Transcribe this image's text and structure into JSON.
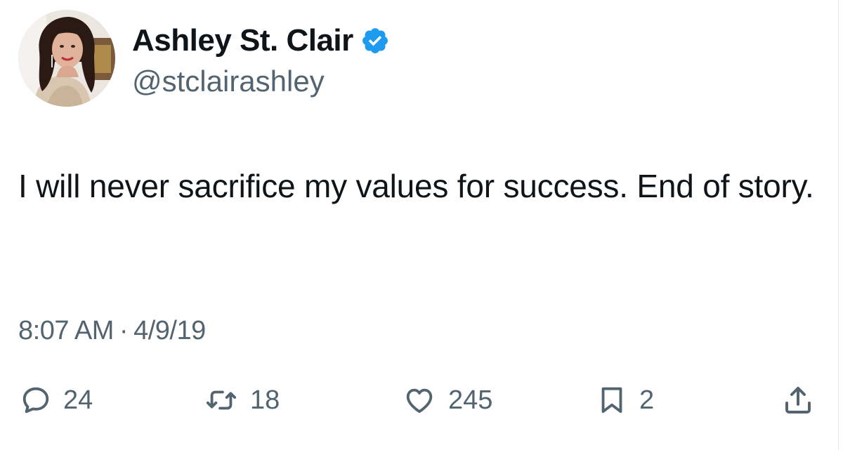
{
  "author": {
    "display_name": "Ashley St. Clair",
    "handle": "@stclairashley",
    "verified": true,
    "verified_color": "#1d9bf0"
  },
  "tweet": {
    "text": "I will never sacrifice my values for success. End of story.",
    "time": "8:07 AM",
    "separator": "·",
    "date": "4/9/19"
  },
  "actions": {
    "reply": {
      "icon": "reply-icon",
      "count": "24"
    },
    "repost": {
      "icon": "repost-icon",
      "count": "18"
    },
    "like": {
      "icon": "heart-icon",
      "count": "245"
    },
    "bookmark": {
      "icon": "bookmark-icon",
      "count": "2"
    },
    "share": {
      "icon": "share-icon"
    }
  },
  "colors": {
    "text": "#0f1419",
    "secondary": "#536471"
  }
}
